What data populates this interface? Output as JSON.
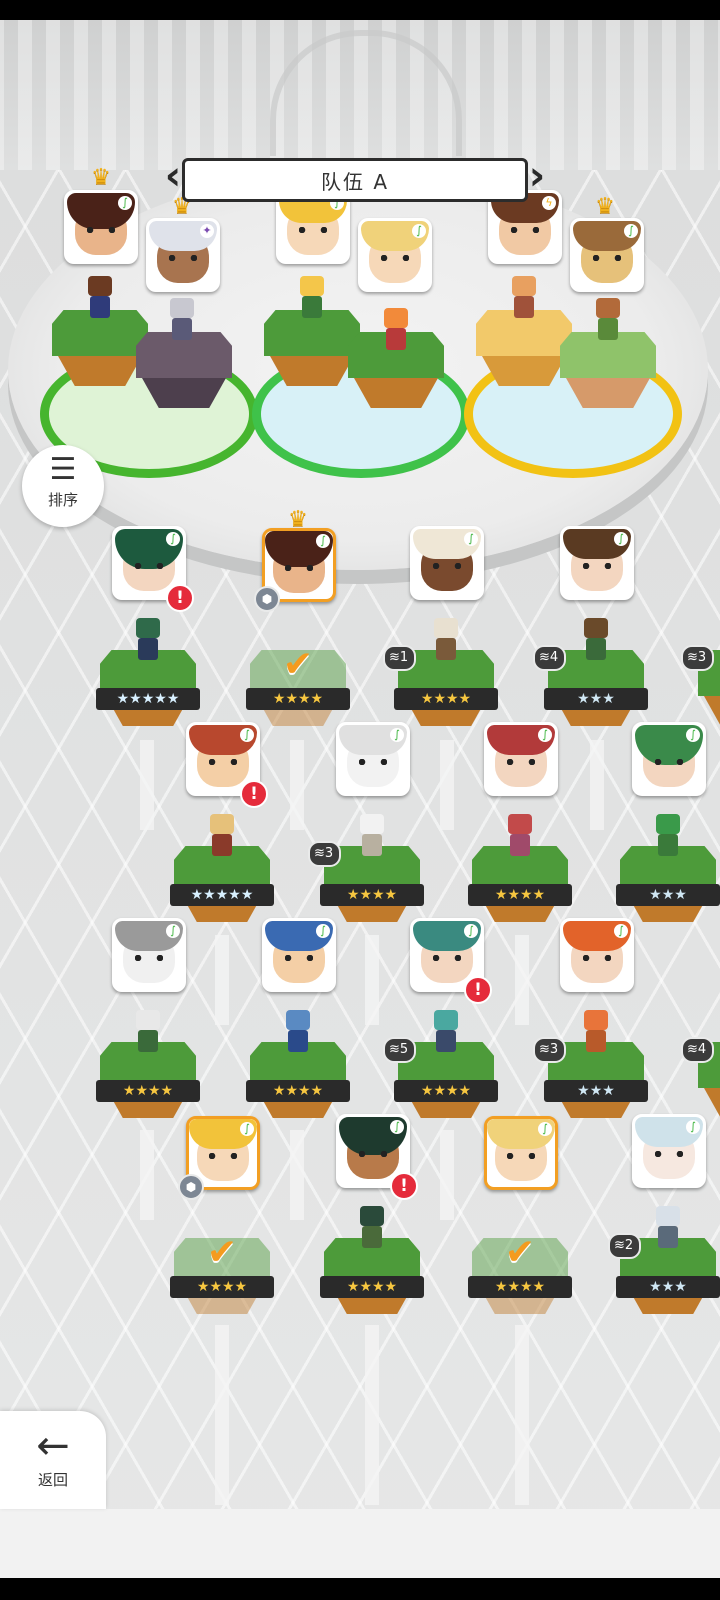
{
  "team": {
    "title": "队伍 A",
    "prev_icon": "chevron-left-icon",
    "next_icon": "chevron-right-icon"
  },
  "sort_button": {
    "icon": "sort-icon",
    "label": "排序"
  },
  "back_button": {
    "icon": "arrow-left-icon",
    "label": "返回"
  },
  "colors": {
    "ring_group1": "#46b52e",
    "ring_group2": "#3fc24a",
    "ring_group3": "#f2c214",
    "selected_border": "#f29f23",
    "warning": "#e52b3b",
    "star_gold": "#f6c640",
    "star_blue": "#cfe6f3"
  },
  "team_slots": [
    {
      "name": "brown-hair-hero",
      "crown": true,
      "element": "leaf"
    },
    {
      "name": "white-haired-warrior",
      "crown": true,
      "element": "dark"
    },
    {
      "name": "blonde-fox-girl",
      "crown": false,
      "element": "leaf"
    },
    {
      "name": "blonde-archer",
      "crown": false,
      "element": "leaf"
    },
    {
      "name": "glasses-girl",
      "crown": false,
      "element": "thunder"
    },
    {
      "name": "owl",
      "crown": true,
      "element": "leaf"
    }
  ],
  "roster": [
    {
      "name": "green-haired-mage",
      "stars": "★★★★★",
      "star_color": "rainbow",
      "warning": "!",
      "level": null,
      "selected": false
    },
    {
      "name": "brown-hair-hero",
      "stars": "★★★★",
      "star_color": "gold",
      "warning": null,
      "level": null,
      "selected": true,
      "crown": true
    },
    {
      "name": "dark-skinned-fighter",
      "stars": "★★★★",
      "star_color": "gold",
      "warning": null,
      "level": "1",
      "selected": false
    },
    {
      "name": "brown-haired-girl",
      "stars": "★★★",
      "star_color": "blue",
      "warning": null,
      "level": "4",
      "selected": false
    },
    {
      "name": "partial-unit-row1",
      "stars": "",
      "star_color": "blue",
      "warning": null,
      "level": "3",
      "selected": false
    },
    {
      "name": "tribal-girl",
      "stars": "★★★★★",
      "star_color": "rainbow",
      "warning": "!",
      "level": null,
      "selected": false
    },
    {
      "name": "white-goat",
      "stars": "★★★★",
      "star_color": "gold",
      "warning": null,
      "level": "3",
      "selected": false
    },
    {
      "name": "red-haired-girl",
      "stars": "★★★★",
      "star_color": "gold",
      "warning": null,
      "level": null,
      "selected": false
    },
    {
      "name": "green-hooded-girl",
      "stars": "★★★",
      "star_color": "blue",
      "warning": null,
      "level": null,
      "selected": false
    },
    {
      "name": "white-tiger",
      "stars": "★★★★",
      "star_color": "gold",
      "warning": null,
      "level": null,
      "selected": false
    },
    {
      "name": "blue-cat-knight",
      "stars": "★★★★",
      "star_color": "gold",
      "warning": null,
      "level": null,
      "selected": false
    },
    {
      "name": "teal-haired-man",
      "stars": "★★★★",
      "star_color": "gold",
      "warning": "!",
      "level": "5",
      "selected": false
    },
    {
      "name": "orange-fox-girl",
      "stars": "★★★",
      "star_color": "blue",
      "warning": null,
      "level": "3",
      "selected": false
    },
    {
      "name": "partial-unit-row3",
      "stars": "",
      "star_color": "blue",
      "warning": null,
      "level": "4",
      "selected": false
    },
    {
      "name": "blonde-fox-girl",
      "stars": "★★★★",
      "star_color": "gold",
      "warning": null,
      "level": null,
      "selected": true
    },
    {
      "name": "dark-green-ranger",
      "stars": "★★★★",
      "star_color": "gold",
      "warning": "!",
      "level": null,
      "selected": false
    },
    {
      "name": "blonde-archer",
      "stars": "★★★★",
      "star_color": "gold",
      "warning": null,
      "level": null,
      "selected": true
    },
    {
      "name": "silver-haired-girl",
      "stars": "★★★",
      "star_color": "blue",
      "warning": null,
      "level": "2",
      "selected": false
    }
  ]
}
